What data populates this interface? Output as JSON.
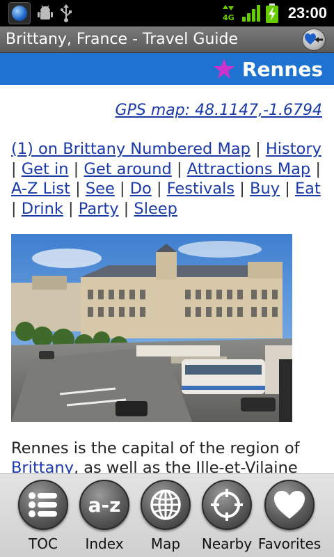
{
  "status_bar": {
    "time": "23:00",
    "network": "4G",
    "icons": [
      "travel-guide-app-icon",
      "android-debug-icon",
      "usb-icon",
      "4g-signal-icon",
      "signal-bars-icon",
      "battery-charging-icon"
    ]
  },
  "title_bar": {
    "title": "Brittany, France - Travel Guide",
    "action_icon": "favorites-back-icon"
  },
  "header": {
    "city": "Rennes",
    "star_color": "#cc33cc",
    "background": "#1e72d0"
  },
  "content": {
    "gps_link": "GPS map: 48.1147,-1.6794",
    "links": [
      "(1) on Brittany Numbered Map",
      "History",
      "Get in",
      "Get around",
      "Attractions Map",
      "A-Z List",
      "See",
      "Do",
      "Festivals",
      "Buy",
      "Eat",
      "Drink",
      "Party",
      "Sleep"
    ],
    "separator": "|",
    "photo_alt": "Rennes",
    "paragraph": {
      "text_before": "Rennes is the capital of the region of ",
      "link": "Brittany",
      "text_after": ", as well as the Ille-et-Vilaine"
    }
  },
  "bottom_nav": {
    "items": [
      {
        "label": "TOC",
        "icon": "toc-list-icon"
      },
      {
        "label": "Index",
        "icon": "a-z-index-icon"
      },
      {
        "label": "Map",
        "icon": "globe-map-icon"
      },
      {
        "label": "Nearby",
        "icon": "crosshair-nearby-icon"
      },
      {
        "label": "Favorites",
        "icon": "heart-favorites-icon"
      }
    ],
    "index_icon_text": "a-z"
  }
}
